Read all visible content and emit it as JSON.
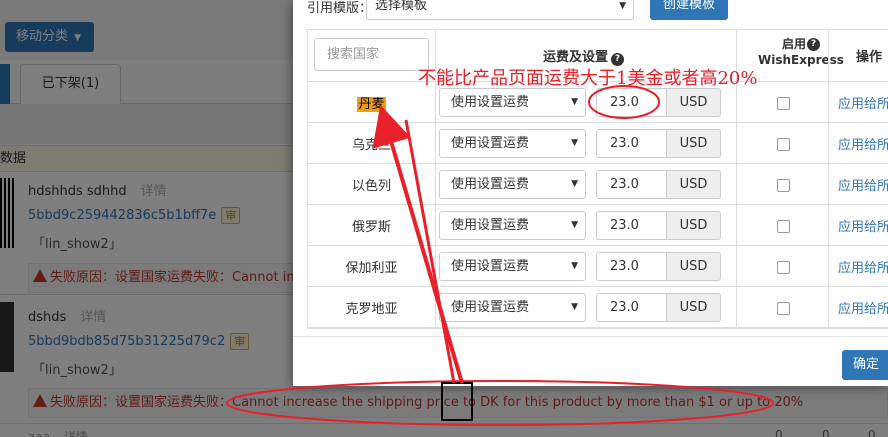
{
  "background": {
    "move_button": "移动分类",
    "tab_offshelf": "已下架(1)",
    "band_label": "数据",
    "products": [
      {
        "name": "hdshhds sdhhd",
        "detail": "详情",
        "sku": "5bbd9c259442836c5b1bff7e",
        "badge": "审",
        "store": "「lin_show2」",
        "fail": "失败原因：设置国家运费失败：Cannot inc"
      },
      {
        "name": "dshds",
        "detail": "详情",
        "sku": "5bbd9bdb85d75b31225d79c2",
        "badge": "审",
        "store": "「lin_show2」",
        "fail": "失败原因：设置国家运费失败：Cannot increase the shipping price to DK for this product by more than $1 or up to 20%"
      }
    ],
    "row3_name": "aaa",
    "row3_detail": "详情",
    "zeros": [
      "0",
      "0",
      "0"
    ]
  },
  "modal": {
    "template_label": "引用模版：",
    "template_select": "选择模板",
    "create_button": "创建模板",
    "search_placeholder": "搜索国家",
    "col_shipping": "运费及设置",
    "col_enable": "启用 WishExpress",
    "col_operation": "操作",
    "rows": [
      {
        "country": "丹麦",
        "mode": "使用设置运费",
        "price": "23.0",
        "currency": "USD",
        "apply": "应用给所有"
      },
      {
        "country": "乌克兰",
        "mode": "使用设置运费",
        "price": "23.0",
        "currency": "USD",
        "apply": "应用给所有"
      },
      {
        "country": "以色列",
        "mode": "使用设置运费",
        "price": "23.0",
        "currency": "USD",
        "apply": "应用给所有"
      },
      {
        "country": "俄罗斯",
        "mode": "使用设置运费",
        "price": "23.0",
        "currency": "USD",
        "apply": "应用给所有"
      },
      {
        "country": "保加利亚",
        "mode": "使用设置运费",
        "price": "23.0",
        "currency": "USD",
        "apply": "应用给所有"
      },
      {
        "country": "克罗地亚",
        "mode": "使用设置运费",
        "price": "23.0",
        "currency": "USD",
        "apply": "应用给所有"
      }
    ],
    "confirm_button": "确定"
  },
  "annotation": {
    "note": "不能比产品页面运费大于1美金或者高20%",
    "color": "#e8202a"
  }
}
